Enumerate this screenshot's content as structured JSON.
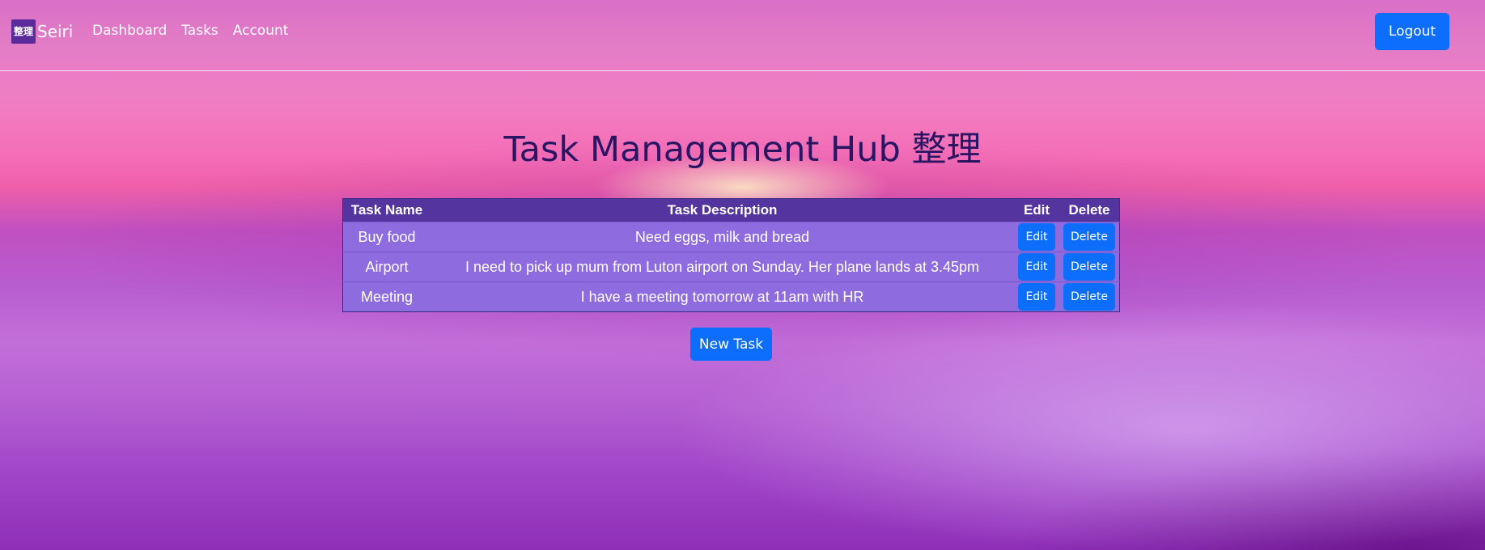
{
  "brand": {
    "logo_text": "整理",
    "name": "Seiri"
  },
  "nav": {
    "links": [
      "Dashboard",
      "Tasks",
      "Account"
    ],
    "logout_label": "Logout"
  },
  "page": {
    "title": "Task Management Hub 整理"
  },
  "table": {
    "headers": {
      "name": "Task Name",
      "description": "Task Description",
      "edit": "Edit",
      "delete": "Delete"
    },
    "rows": [
      {
        "name": "Buy food",
        "description": "Need eggs, milk and bread",
        "edit_label": "Edit",
        "delete_label": "Delete"
      },
      {
        "name": "Airport",
        "description": "I need to pick up mum from Luton airport on Sunday. Her plane lands at 3.45pm",
        "edit_label": "Edit",
        "delete_label": "Delete"
      },
      {
        "name": "Meeting",
        "description": "I have a meeting tomorrow at 11am with HR",
        "edit_label": "Edit",
        "delete_label": "Delete"
      }
    ]
  },
  "actions": {
    "new_task_label": "New Task"
  },
  "colors": {
    "primary_button": "#0d6efd",
    "table_header": "#5435a0",
    "table_row": "#8e6bdf",
    "title": "#2a1563"
  }
}
